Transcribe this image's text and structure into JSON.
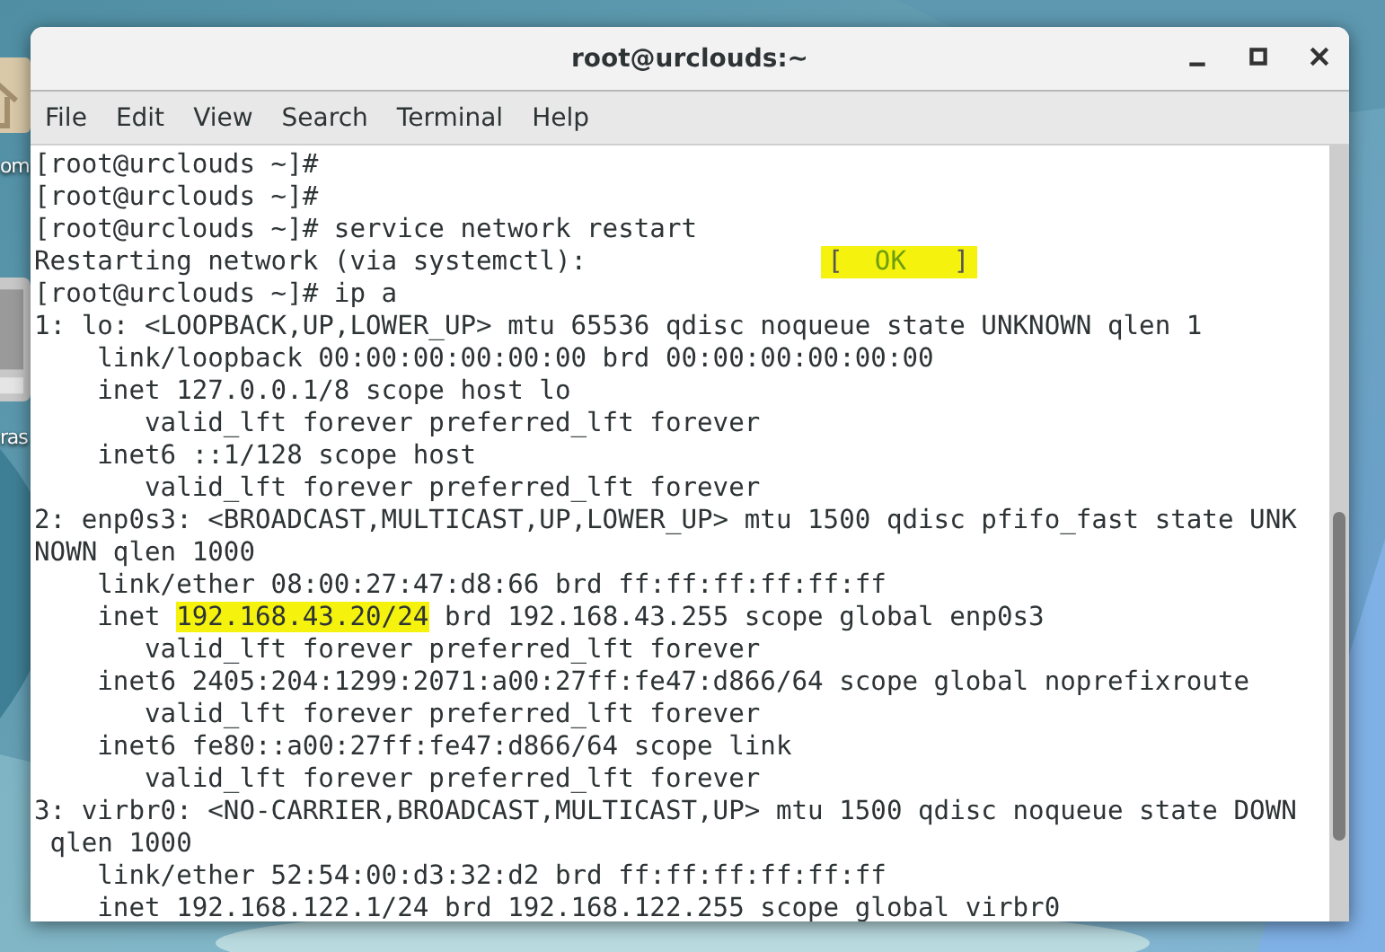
{
  "desktop": {
    "icons": [
      {
        "kind": "home",
        "label": "om"
      },
      {
        "kind": "drive",
        "label": "ras"
      }
    ]
  },
  "window": {
    "title": "root@urclouds:~"
  },
  "menu": [
    "File",
    "Edit",
    "View",
    "Search",
    "Terminal",
    "Help"
  ],
  "terminal": {
    "lines": [
      {
        "segments": [
          {
            "text": "[root@urclouds ~]#",
            "highlighted": false
          }
        ]
      },
      {
        "segments": [
          {
            "text": "[root@urclouds ~]#",
            "highlighted": false
          }
        ]
      },
      {
        "segments": [
          {
            "text": "[root@urclouds ~]# service network restart",
            "highlighted": false
          }
        ]
      },
      {
        "segments": [
          {
            "text": "Restarting network (via systemctl):",
            "highlighted": false
          }
        ],
        "status": [
          {
            "text": "[",
            "kind": "bracket"
          },
          {
            "text": "OK",
            "kind": "ok"
          },
          {
            "text": "]",
            "kind": "bracket"
          }
        ]
      },
      {
        "segments": [
          {
            "text": "[root@urclouds ~]# ip a",
            "highlighted": false
          }
        ]
      },
      {
        "segments": [
          {
            "text": "1: lo: <LOOPBACK,UP,LOWER_UP> mtu 65536 qdisc noqueue state UNKNOWN qlen 1",
            "highlighted": false
          }
        ]
      },
      {
        "segments": [
          {
            "text": "    link/loopback 00:00:00:00:00:00 brd 00:00:00:00:00:00",
            "highlighted": false
          }
        ]
      },
      {
        "segments": [
          {
            "text": "    inet 127.0.0.1/8 scope host lo",
            "highlighted": false
          }
        ]
      },
      {
        "segments": [
          {
            "text": "       valid_lft forever preferred_lft forever",
            "highlighted": false
          }
        ]
      },
      {
        "segments": [
          {
            "text": "    inet6 ::1/128 scope host",
            "highlighted": false
          }
        ]
      },
      {
        "segments": [
          {
            "text": "       valid_lft forever preferred_lft forever",
            "highlighted": false
          }
        ]
      },
      {
        "segments": [
          {
            "text": "2: enp0s3: <BROADCAST,MULTICAST,UP,LOWER_UP> mtu 1500 qdisc pfifo_fast state UNK",
            "highlighted": false
          }
        ]
      },
      {
        "segments": [
          {
            "text": "NOWN qlen 1000",
            "highlighted": false
          }
        ]
      },
      {
        "segments": [
          {
            "text": "    link/ether 08:00:27:47:d8:66 brd ff:ff:ff:ff:ff:ff",
            "highlighted": false
          }
        ]
      },
      {
        "segments": [
          {
            "text": "    inet ",
            "highlighted": false
          },
          {
            "text": "192.168.43.20/24",
            "highlighted": true
          },
          {
            "text": " brd 192.168.43.255 scope global enp0s3",
            "highlighted": false
          }
        ]
      },
      {
        "segments": [
          {
            "text": "       valid_lft forever preferred_lft forever",
            "highlighted": false
          }
        ]
      },
      {
        "segments": [
          {
            "text": "    inet6 2405:204:1299:2071:a00:27ff:fe47:d866/64 scope global noprefixroute",
            "highlighted": false
          }
        ]
      },
      {
        "segments": [
          {
            "text": "       valid_lft forever preferred_lft forever",
            "highlighted": false
          }
        ]
      },
      {
        "segments": [
          {
            "text": "    inet6 fe80::a00:27ff:fe47:d866/64 scope link",
            "highlighted": false
          }
        ]
      },
      {
        "segments": [
          {
            "text": "       valid_lft forever preferred_lft forever",
            "highlighted": false
          }
        ]
      },
      {
        "segments": [
          {
            "text": "3: virbr0: <NO-CARRIER,BROADCAST,MULTICAST,UP> mtu 1500 qdisc noqueue state DOWN",
            "highlighted": false
          }
        ]
      },
      {
        "segments": [
          {
            "text": " qlen 1000",
            "highlighted": false
          }
        ]
      },
      {
        "segments": [
          {
            "text": "    link/ether 52:54:00:d3:32:d2 brd ff:ff:ff:ff:ff:ff",
            "highlighted": false
          }
        ]
      },
      {
        "segments": [
          {
            "text": "    inet 192.168.122.1/24 brd 192.168.122.255 scope global virbr0",
            "highlighted": false
          }
        ]
      }
    ]
  }
}
